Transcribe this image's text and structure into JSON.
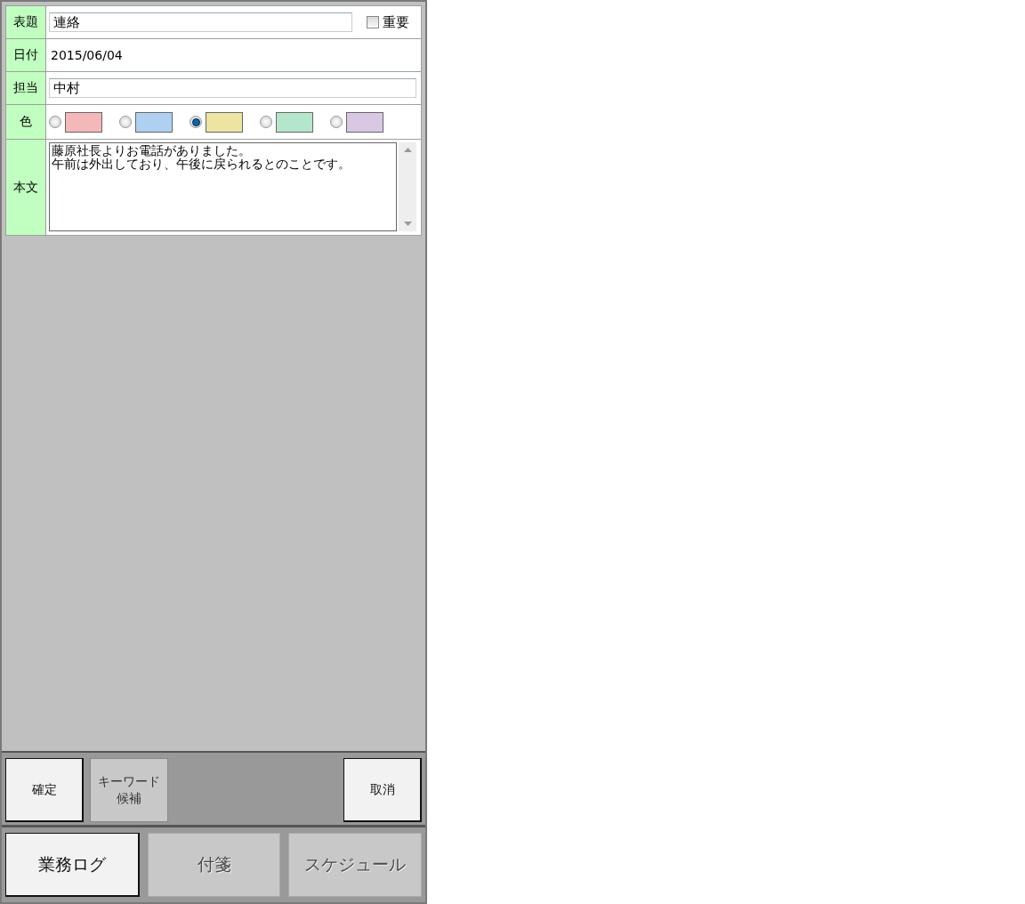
{
  "form": {
    "rows": [
      {
        "kind": "text",
        "label": "表題",
        "value": "連絡",
        "checkbox": {
          "label": "重要",
          "checked": false
        }
      },
      {
        "kind": "static",
        "label": "日付",
        "value": "2015/06/04"
      },
      {
        "kind": "text",
        "label": "担当",
        "value": "中村"
      },
      {
        "kind": "colors",
        "label": "色",
        "options": [
          {
            "color": "#f4b8b8",
            "selected": false
          },
          {
            "color": "#b0d0f2",
            "selected": false
          },
          {
            "color": "#ece4a0",
            "selected": true
          },
          {
            "color": "#b4e6cc",
            "selected": false
          },
          {
            "color": "#d8c8e4",
            "selected": false
          }
        ]
      },
      {
        "kind": "textarea",
        "label": "本文",
        "lines": [
          "藤原社長よりお電話がありました。",
          "午前は外出しており、午後に戻られるとのことです。"
        ]
      }
    ]
  },
  "actions": [
    {
      "lines": [
        "確定"
      ],
      "disabled": false
    },
    {
      "lines": [
        "キーワード",
        "候補"
      ],
      "disabled": true
    },
    {
      "lines": [
        "取消"
      ],
      "disabled": false
    }
  ],
  "tabs": [
    {
      "label": "業務ログ",
      "selected": true
    },
    {
      "label": "付箋",
      "selected": false
    },
    {
      "label": "スケジュール",
      "selected": false
    }
  ]
}
